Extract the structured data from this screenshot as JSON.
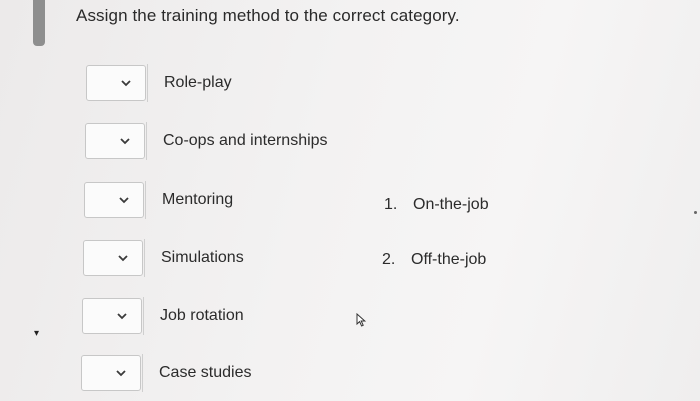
{
  "question": {
    "title": "Assign the training method to the correct category."
  },
  "items": [
    {
      "label": "Role-play",
      "selected": ""
    },
    {
      "label": "Co-ops and internships",
      "selected": ""
    },
    {
      "label": "Mentoring",
      "selected": ""
    },
    {
      "label": "Simulations",
      "selected": ""
    },
    {
      "label": "Job rotation",
      "selected": ""
    },
    {
      "label": "Case studies",
      "selected": ""
    }
  ],
  "answers": [
    {
      "number": "1.",
      "label": "On-the-job"
    },
    {
      "number": "2.",
      "label": "Off-the-job"
    }
  ],
  "icons": {
    "dropdown": "chevron-down-icon",
    "cursor": "mouse-pointer-icon"
  },
  "colors": {
    "border": "#c7c7c7",
    "scrollbar": "#8e8e8e",
    "text": "#2b2b2b"
  }
}
